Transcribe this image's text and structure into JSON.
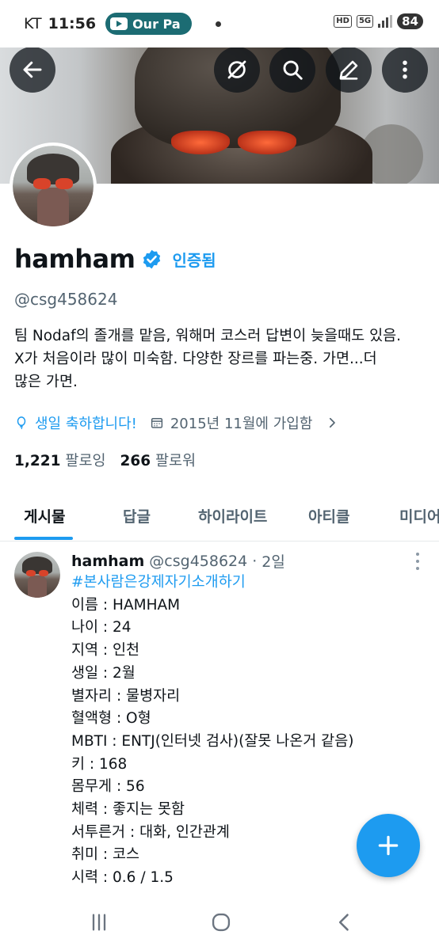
{
  "status_bar": {
    "carrier": "KT",
    "time": "11:56",
    "pill_label": "Our Pa",
    "hd": "HD",
    "net": "5G",
    "battery": "84"
  },
  "profile": {
    "name": "hamham",
    "verified_label": "인증됨",
    "handle": "@csg458624",
    "bio_lines": [
      "팀 Nodaf의 졸개를 맡음, 워해머 코스러 답변이 늦을때도 있음.",
      "X가 처음이라 많이 미숙함. 다양한 장르를 파는중. 가면...더",
      "많은 가면."
    ],
    "birthday": "생일 축하합니다!",
    "joined": "2015년 11월에 가입함",
    "following_count": "1,221",
    "following_label": "팔로잉",
    "followers_count": "266",
    "followers_label": "팔로워"
  },
  "tabs": [
    "게시물",
    "답글",
    "하이라이트",
    "아티클",
    "미디어"
  ],
  "post": {
    "name": "hamham",
    "handle": "@csg458624",
    "sep": "·",
    "time": "2일",
    "hashtag": "#본사람은강제자기소개하기",
    "lines": [
      "이름 : HAMHAM",
      "나이 : 24",
      "지역 : 인천",
      "생일 : 2월",
      "별자리 : 물병자리",
      "혈액형 : O형",
      "MBTI : ENTJ(인터넷 검사)(잘못 나온거 같음)",
      "키 : 168",
      "몸무게 : 56",
      "체력 : 좋지는 못함",
      "서투른거 : 대화, 인간관계",
      "취미 : 코스",
      "시력 : 0.6 / 1.5"
    ]
  },
  "icons": {
    "back": "back-arrow-icon",
    "grok": "grok-icon",
    "search": "search-icon",
    "edit": "edit-icon",
    "more": "more-vertical-icon",
    "verified": "verified-badge-icon",
    "balloon": "balloon-icon",
    "calendar": "calendar-icon",
    "compose": "plus-icon"
  },
  "colors": {
    "accent": "#1d9bf0",
    "text": "#0f1419",
    "muted": "#536471"
  }
}
